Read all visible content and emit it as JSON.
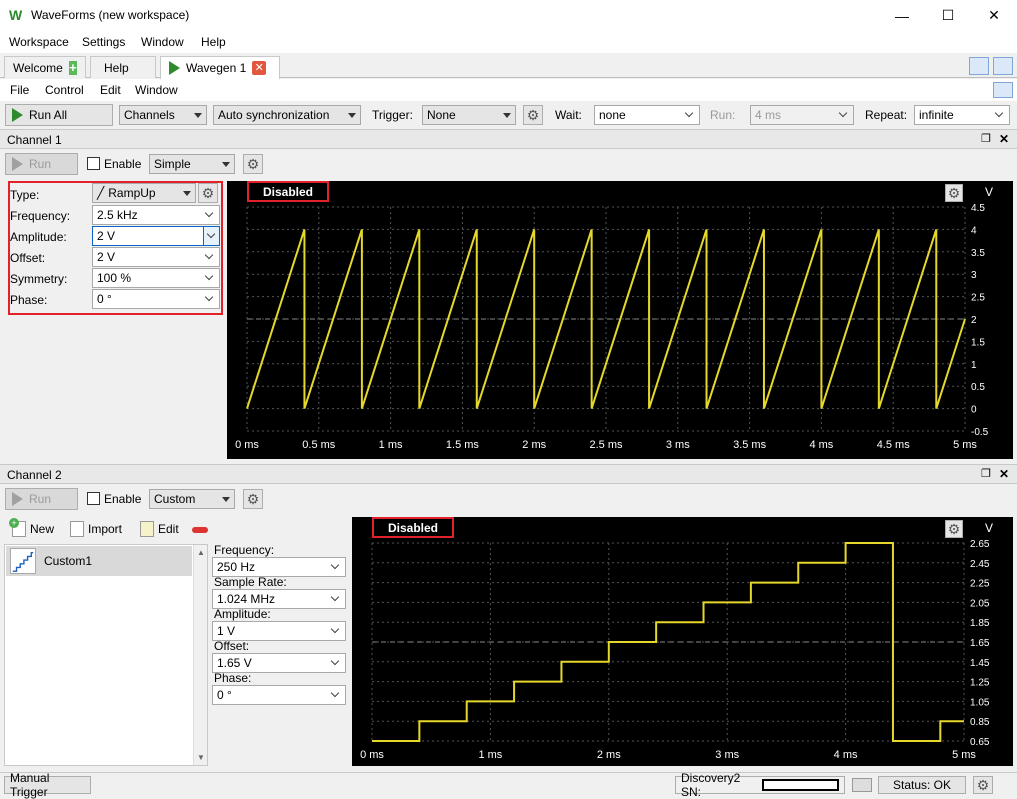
{
  "window": {
    "title": "WaveForms (new workspace)",
    "minimize": "—",
    "maximize": "☐",
    "close": "✕"
  },
  "menu": [
    "Workspace",
    "Settings",
    "Window",
    "Help"
  ],
  "tabs": [
    {
      "label": "Welcome"
    },
    {
      "label": "Help"
    },
    {
      "label": "Wavegen 1"
    }
  ],
  "submenu": [
    "File",
    "Control",
    "Edit",
    "Window"
  ],
  "toolbar": {
    "run_all": "Run All",
    "channels": "Channels",
    "sync": "Auto synchronization",
    "trigger_label": "Trigger:",
    "trigger_value": "None",
    "wait_label": "Wait:",
    "wait_value": "none",
    "run_label": "Run:",
    "run_value": "4 ms",
    "repeat_label": "Repeat:",
    "repeat_value": "infinite"
  },
  "channel1": {
    "title": "Channel 1",
    "run": "Run",
    "enable": "Enable",
    "mode": "Simple",
    "params": [
      {
        "label": "Type:",
        "value": "RampUp"
      },
      {
        "label": "Frequency:",
        "value": "2.5 kHz"
      },
      {
        "label": "Amplitude:",
        "value": "2 V"
      },
      {
        "label": "Offset:",
        "value": "2 V"
      },
      {
        "label": "Symmetry:",
        "value": "100 %"
      },
      {
        "label": "Phase:",
        "value": "0 °"
      }
    ],
    "plot": {
      "badge": "Disabled",
      "unit": "V",
      "yticks": [
        "4.5",
        "4",
        "3.5",
        "3",
        "2.5",
        "2",
        "1.5",
        "1",
        "0.5",
        "0",
        "-0.5"
      ],
      "xticks": [
        "0 ms",
        "0.5 ms",
        "1 ms",
        "1.5 ms",
        "2 ms",
        "2.5 ms",
        "3 ms",
        "3.5 ms",
        "4 ms",
        "4.5 ms",
        "5 ms"
      ]
    }
  },
  "channel2": {
    "title": "Channel 2",
    "run": "Run",
    "enable": "Enable",
    "mode": "Custom",
    "new": "New",
    "import": "Import",
    "edit": "Edit",
    "list_item": "Custom1",
    "params": [
      {
        "label": "Frequency:",
        "value": "250 Hz"
      },
      {
        "label": "Sample Rate:",
        "value": "1.024 MHz"
      },
      {
        "label": "Amplitude:",
        "value": "1 V"
      },
      {
        "label": "Offset:",
        "value": "1.65 V"
      },
      {
        "label": "Phase:",
        "value": "0 °"
      }
    ],
    "plot": {
      "badge": "Disabled",
      "unit": "V",
      "yticks": [
        "2.65",
        "2.45",
        "2.25",
        "2.05",
        "1.85",
        "1.65",
        "1.45",
        "1.25",
        "1.05",
        "0.85",
        "0.65"
      ],
      "xticks": [
        "0 ms",
        "1 ms",
        "2 ms",
        "3 ms",
        "4 ms",
        "5 ms"
      ]
    }
  },
  "status": {
    "manual_trigger": "Manual Trigger",
    "device": "Discovery2 SN:",
    "status": "Status: OK"
  },
  "chart_data": [
    {
      "type": "line",
      "series": [
        {
          "waveform": "RampUp",
          "frequency_khz": 2.5,
          "amplitude_v": 2,
          "offset_v": 2
        }
      ],
      "x": [
        0,
        0.4,
        0.4,
        0.8,
        0.8,
        1.2,
        1.2,
        1.6,
        1.6,
        2.0,
        2.0,
        2.4,
        2.4,
        2.8,
        2.8,
        3.2,
        3.2,
        3.6,
        3.6,
        4.0,
        4.0,
        4.4,
        4.4,
        4.8,
        4.8,
        5.0
      ],
      "y": [
        0,
        4,
        0,
        4,
        0,
        4,
        0,
        4,
        0,
        4,
        0,
        4,
        0,
        4,
        0,
        4,
        0,
        4,
        0,
        4,
        0,
        4,
        0,
        4,
        0,
        2
      ],
      "xlim": [
        0,
        5
      ],
      "ylim": [
        -0.5,
        4.5
      ],
      "grid": true,
      "color": "#e5d82a"
    },
    {
      "type": "line",
      "series": [
        {
          "waveform": "Custom1"
        }
      ],
      "x": [
        0,
        0.4,
        0.4,
        0.8,
        0.8,
        1.2,
        1.2,
        1.6,
        1.6,
        2.0,
        2.0,
        2.4,
        2.4,
        2.8,
        2.8,
        3.2,
        3.2,
        3.6,
        3.6,
        4.0,
        4.0,
        4.4,
        4.4,
        4.8,
        4.8,
        5.0
      ],
      "y": [
        0.65,
        0.65,
        0.85,
        0.85,
        1.05,
        1.05,
        1.25,
        1.25,
        1.45,
        1.45,
        1.65,
        1.65,
        1.85,
        1.85,
        2.05,
        2.05,
        2.25,
        2.25,
        2.45,
        2.45,
        2.65,
        2.65,
        0.65,
        0.65,
        0.85,
        0.85
      ],
      "xlim": [
        0,
        5
      ],
      "ylim": [
        0.65,
        2.65
      ],
      "grid": true,
      "color": "#e5d82a"
    }
  ]
}
